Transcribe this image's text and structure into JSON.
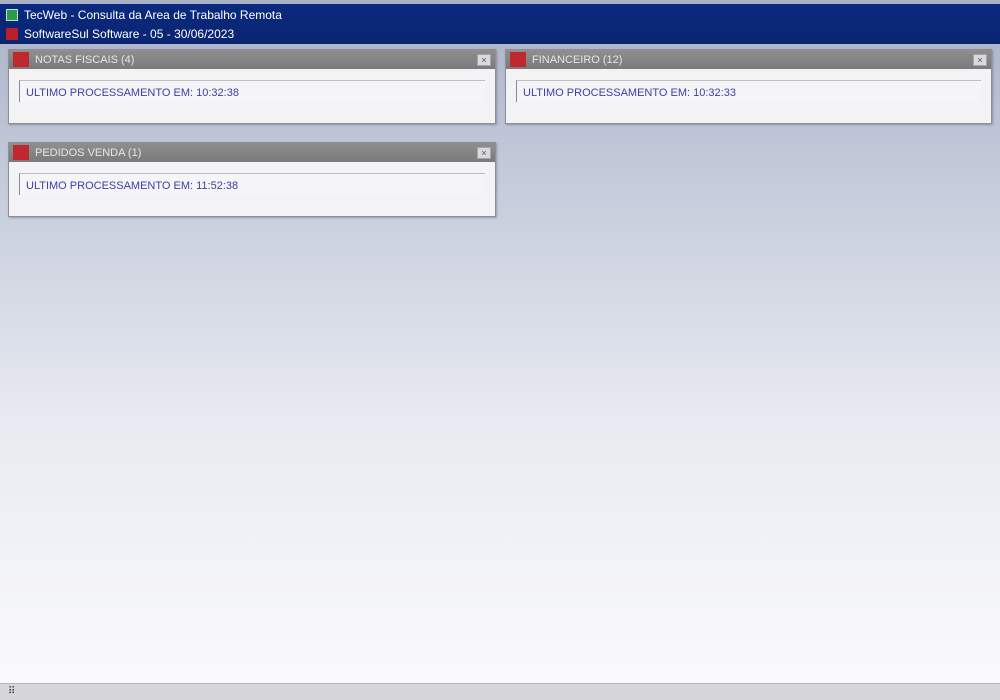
{
  "titlebar": {
    "line1": "TecWeb - Consulta da Area de Trabalho Remota",
    "line2": "SoftwareSul Software - 05 - 30/06/2023"
  },
  "panels": [
    {
      "title": "NOTAS FISCAIS (4)",
      "text": "ULTIMO PROCESSAMENTO EM: 10:32:38",
      "button": "×"
    },
    {
      "title": "FINANCEIRO (12)",
      "text": "ULTIMO PROCESSAMENTO EM: 10:32:33",
      "button": "×"
    },
    {
      "title": "PEDIDOS VENDA (1)",
      "text": "ULTIMO PROCESSAMENTO EM: 11:52:38",
      "button": "×"
    }
  ],
  "statusbar": {
    "grip": "⠿"
  }
}
